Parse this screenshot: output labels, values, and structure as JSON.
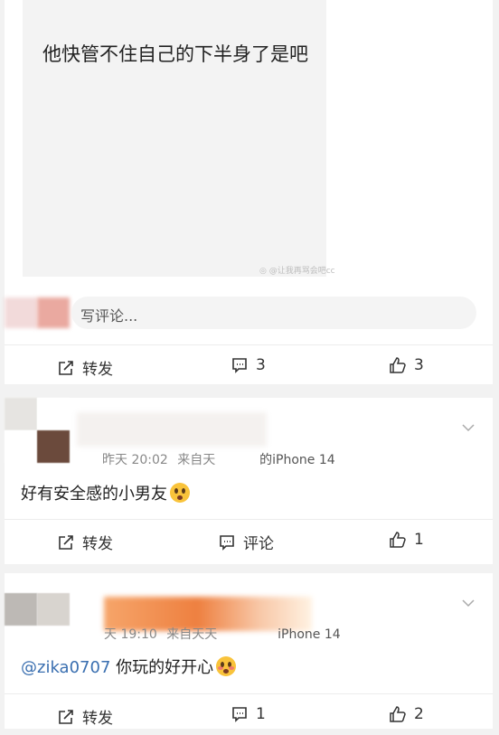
{
  "post": {
    "image_text": "他快管不住自己的下半身了是吧",
    "watermark": "@让我再骂会吧cc",
    "comment_placeholder": "写评论...",
    "actions": {
      "repost": "转发",
      "comment_count": "3",
      "like_count": "3"
    }
  },
  "comments": [
    {
      "time": "昨天 20:02",
      "source_prefix": "来自天",
      "device": "的iPhone 14",
      "text": "好有安全感的小男友",
      "emoji": "astonished-face",
      "actions": {
        "repost": "转发",
        "comment": "评论",
        "like_count": "1"
      }
    },
    {
      "time": "天 19:10",
      "source_prefix": "来自天天",
      "device": "iPhone 14",
      "mention": "@zika0707",
      "text": "你玩的好开心",
      "emoji": "blushing-face",
      "actions": {
        "repost": "转发",
        "comment_count": "1",
        "like_count": "2"
      }
    }
  ],
  "colors": {
    "mention": "#3a6fb0",
    "background": "#f2f2f2",
    "card": "#ffffff"
  }
}
